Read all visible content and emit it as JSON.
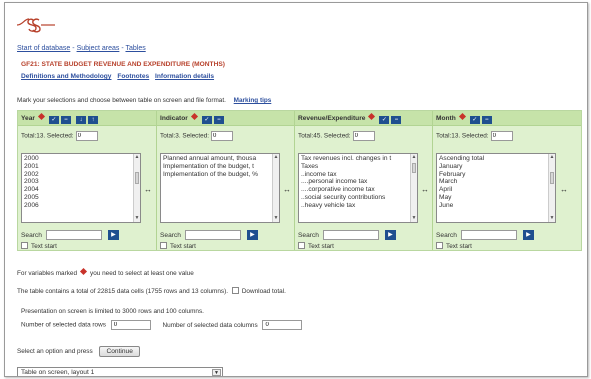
{
  "breadcrumb": {
    "items": [
      "Start of database",
      "Subject areas",
      "Tables"
    ],
    "separator": " - "
  },
  "table_title": "GF21: STATE BUDGET REVENUE AND EXPENDITURE (MONTHS)",
  "info_links": [
    "Definitions and Methodology",
    "Footnotes",
    "Information details"
  ],
  "instruction": "Mark your selections and choose between table on screen and file format.",
  "marking_tips": "Marking tips",
  "variables": [
    {
      "name": "Year",
      "total": "Total:13. Selected:",
      "selected": "0",
      "items": [
        "2000",
        "2001",
        "2002",
        "2003",
        "2004",
        "2005",
        "2006"
      ],
      "search_label": "Search",
      "text_start": "Text start"
    },
    {
      "name": "Indicator",
      "total": "Total:3. Selected:",
      "selected": "0",
      "items": [
        "Planned annual amount, thousa",
        "Implementation of the budget, t",
        "Implementation of the budget, %"
      ],
      "search_label": "Search",
      "text_start": "Text start"
    },
    {
      "name": "Revenue/Expenditure",
      "total": "Total:45. Selected:",
      "selected": "0",
      "items": [
        "Tax revenues incl. changes in t",
        "Taxes",
        "..income tax",
        "....personal income tax",
        "....corporative income tax",
        "..social security contributions",
        "..heavy vehicle tax"
      ],
      "search_label": "Search",
      "text_start": "Text start"
    },
    {
      "name": "Month",
      "total": "Total:13. Selected:",
      "selected": "0",
      "items": [
        "Ascending total",
        "January",
        "February",
        "March",
        "April",
        "May",
        "June"
      ],
      "search_label": "Search",
      "text_start": "Text start"
    }
  ],
  "required_note_pre": "For variables marked",
  "required_note_post": "you need to select at least one value",
  "cells_note": "The table contains a total of 22815 data cells (1755 rows and 13 columns).",
  "download_total": "Download total.",
  "limit_note": "Presentation on screen is limited to 3000 rows and 100 columns.",
  "rows_label": "Number of selected data rows",
  "rows_value": "0",
  "cols_label": "Number of selected data columns",
  "cols_value": "0",
  "press_label": "Select an option and press",
  "continue_label": "Continue",
  "output_option": "Table on screen, layout 1",
  "colors": {
    "panel": "#dff1cf",
    "header": "#c6e3a9",
    "title": "#b7412b",
    "link": "#2d4f9e",
    "icon": "#1f4f8f"
  }
}
